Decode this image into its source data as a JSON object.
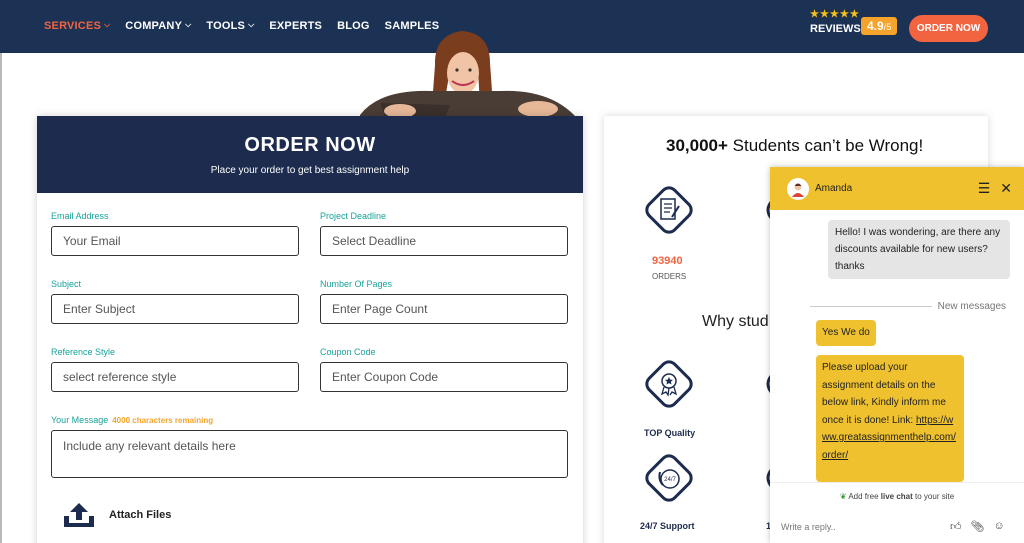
{
  "nav": {
    "items": [
      {
        "label": "SERVICES",
        "dropdown": true,
        "active": true
      },
      {
        "label": "COMPANY",
        "dropdown": true,
        "active": false
      },
      {
        "label": "TOOLS",
        "dropdown": true,
        "active": false
      },
      {
        "label": "EXPERTS",
        "dropdown": false,
        "active": false
      },
      {
        "label": "BLOG",
        "dropdown": false,
        "active": false
      },
      {
        "label": "SAMPLES",
        "dropdown": false,
        "active": false
      }
    ],
    "stars": "★★★★★",
    "reviews_label": "REVIEWS",
    "rating": "4.9",
    "rating_scale": "/5",
    "order_button": "ORDER NOW"
  },
  "form": {
    "title": "ORDER NOW",
    "subtitle": "Place your order to get best assignment help",
    "fields": {
      "email": {
        "label": "Email Address",
        "placeholder": "Your Email"
      },
      "deadline": {
        "label": "Project Deadline",
        "placeholder": "Select Deadline"
      },
      "subject": {
        "label": "Subject",
        "placeholder": "Enter Subject"
      },
      "pages": {
        "label": "Number Of Pages",
        "placeholder": "Enter Page Count"
      },
      "reference": {
        "label": "Reference Style",
        "placeholder": "select reference style"
      },
      "coupon": {
        "label": "Coupon Code",
        "placeholder": "Enter Coupon Code"
      },
      "message": {
        "label": "Your Message",
        "remaining": "4000 characters remaining",
        "placeholder": "Include any relevant details here"
      }
    },
    "attach_label": "Attach Files"
  },
  "stats": {
    "title_bold": "30,000+",
    "title_rest": " Students can’t be Wrong!",
    "orders_count": "93940",
    "orders_label": "ORDERS",
    "why_title": "Why stud",
    "top_quality": "TOP Quality",
    "support": "24/7 Support",
    "partial_label": "1"
  },
  "chat": {
    "agent_name": "Amanda",
    "incoming": "Hello! I was wondering, are there any discounts available for new users? thanks",
    "new_messages": "New messages",
    "reply_1": "Yes We do",
    "reply_2_text": "Please upload your assignment details on the below link, Kindly inform me once it is done! Link:",
    "reply_2_link": "https://www.greatassignmenthelp.com/order/",
    "footer_pre": "Add free ",
    "footer_bold": "live chat",
    "footer_post": " to your site",
    "reply_placeholder": "Write a reply.."
  }
}
